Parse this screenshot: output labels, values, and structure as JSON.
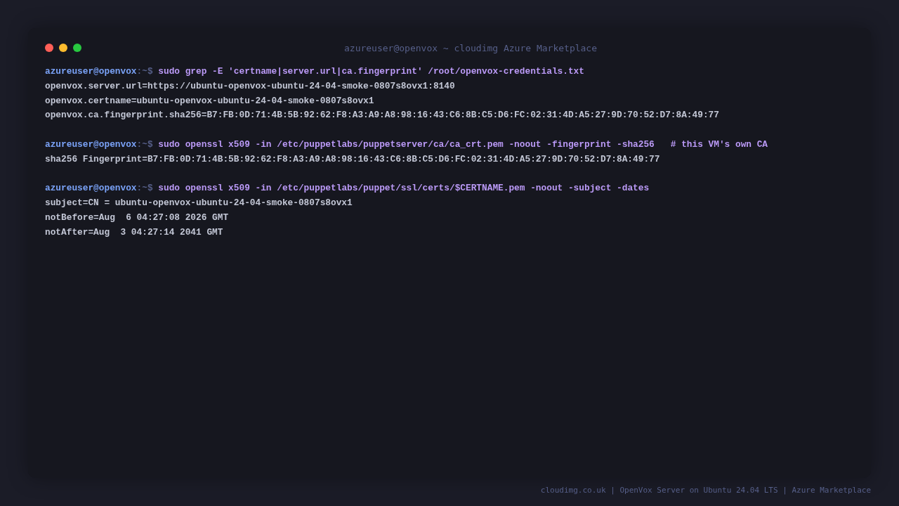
{
  "window": {
    "title": "azureuser@openvox ~ cloudimg Azure Marketplace",
    "buttons": [
      {
        "color": "#ff5f57"
      },
      {
        "color": "#febc2e"
      },
      {
        "color": "#28c840"
      }
    ]
  },
  "session": [
    {
      "prompt": {
        "user_host": "azureuser@openvox",
        "suffix": ":~$"
      },
      "command": "sudo grep -E 'certname|server.url|ca.fingerprint' /root/openvox-credentials.txt",
      "output": [
        "openvox.server.url=https://ubuntu-openvox-ubuntu-24-04-smoke-0807s8ovx1:8140",
        "openvox.certname=ubuntu-openvox-ubuntu-24-04-smoke-0807s8ovx1",
        "openvox.ca.fingerprint.sha256=B7:FB:0D:71:4B:5B:92:62:F8:A3:A9:A8:98:16:43:C6:8B:C5:D6:FC:02:31:4D:A5:27:9D:70:52:D7:8A:49:77"
      ]
    },
    {
      "prompt": {
        "user_host": "azureuser@openvox",
        "suffix": ":~$"
      },
      "command": "sudo openssl x509 -in /etc/puppetlabs/puppetserver/ca/ca_crt.pem -noout -fingerprint -sha256   # this VM's own CA",
      "output": [
        "sha256 Fingerprint=B7:FB:0D:71:4B:5B:92:62:F8:A3:A9:A8:98:16:43:C6:8B:C5:D6:FC:02:31:4D:A5:27:9D:70:52:D7:8A:49:77"
      ]
    },
    {
      "prompt": {
        "user_host": "azureuser@openvox",
        "suffix": ":~$"
      },
      "command": "sudo openssl x509 -in /etc/puppetlabs/puppet/ssl/certs/$CERTNAME.pem -noout -subject -dates",
      "output": [
        "subject=CN = ubuntu-openvox-ubuntu-24-04-smoke-0807s8ovx1",
        "notBefore=Aug  6 04:27:08 2026 GMT",
        "notAfter=Aug  3 04:27:14 2041 GMT"
      ]
    }
  ],
  "footer": "cloudimg.co.uk | OpenVox Server on Ubuntu 24.04 LTS | Azure Marketplace"
}
